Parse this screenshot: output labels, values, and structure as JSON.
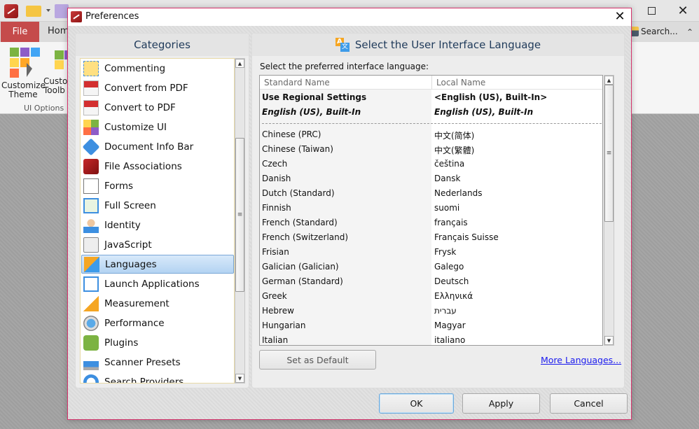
{
  "app": {
    "ribbon_tabs": {
      "file": "File",
      "home": "Hom"
    },
    "ribbon_search": "Search...",
    "ribbon_buttons": [
      {
        "label_line1": "Customize",
        "label_line2": "Theme"
      },
      {
        "label_line1": "Custo",
        "label_line2": "Toolb"
      }
    ],
    "ribbon_group_label": "UI Options",
    "window_controls": {
      "maximize": "□",
      "close": "✕"
    }
  },
  "dialog": {
    "title": "Preferences",
    "close_glyph": "✕",
    "categories": {
      "heading": "Categories",
      "selected": "Languages",
      "items": [
        {
          "label": "Commenting",
          "icon": "commenting-icon"
        },
        {
          "label": "Convert from PDF",
          "icon": "convert-from-pdf-icon"
        },
        {
          "label": "Convert to PDF",
          "icon": "convert-to-pdf-icon"
        },
        {
          "label": "Customize UI",
          "icon": "customize-ui-icon"
        },
        {
          "label": "Document Info Bar",
          "icon": "info-icon"
        },
        {
          "label": "File Associations",
          "icon": "pdf-file-icon"
        },
        {
          "label": "Forms",
          "icon": "forms-icon"
        },
        {
          "label": "Full Screen",
          "icon": "full-screen-icon"
        },
        {
          "label": "Identity",
          "icon": "user-icon"
        },
        {
          "label": "JavaScript",
          "icon": "script-gear-icon"
        },
        {
          "label": "Languages",
          "icon": "language-icon"
        },
        {
          "label": "Launch Applications",
          "icon": "launch-app-icon"
        },
        {
          "label": "Measurement",
          "icon": "ruler-triangle-icon"
        },
        {
          "label": "Performance",
          "icon": "gauge-icon"
        },
        {
          "label": "Plugins",
          "icon": "puzzle-icon"
        },
        {
          "label": "Scanner Presets",
          "icon": "scanner-icon"
        },
        {
          "label": "Search Providers",
          "icon": "globe-icon"
        }
      ]
    },
    "languages": {
      "heading": "Select the User Interface Language",
      "prompt": "Select the preferred interface language:",
      "columns": [
        "Standard Name",
        "Local Name"
      ],
      "pinned_rows": [
        {
          "standard": "Use Regional Settings",
          "local": "<English (US), Built-In>",
          "style": "bold"
        },
        {
          "standard": "English (US), Built-In",
          "local": "English (US), Built-In",
          "style": "bolditalic"
        }
      ],
      "rows": [
        {
          "standard": "Chinese (PRC)",
          "local": "中文(简体)"
        },
        {
          "standard": "Chinese (Taiwan)",
          "local": "中文(繁體)"
        },
        {
          "standard": "Czech",
          "local": "čeština"
        },
        {
          "standard": "Danish",
          "local": "Dansk"
        },
        {
          "standard": "Dutch (Standard)",
          "local": "Nederlands"
        },
        {
          "standard": "Finnish",
          "local": "suomi"
        },
        {
          "standard": "French (Standard)",
          "local": "français"
        },
        {
          "standard": "French (Switzerland)",
          "local": "Français Suisse"
        },
        {
          "standard": "Frisian",
          "local": "Frysk"
        },
        {
          "standard": "Galician (Galician)",
          "local": "Galego"
        },
        {
          "standard": "German (Standard)",
          "local": "Deutsch"
        },
        {
          "standard": "Greek",
          "local": "Ελληνικά"
        },
        {
          "standard": "Hebrew",
          "local": "עברית"
        },
        {
          "standard": "Hungarian",
          "local": "Magyar"
        },
        {
          "standard": "Italian",
          "local": "italiano"
        }
      ],
      "set_default_label": "Set as Default",
      "more_languages_label": "More Languages..."
    },
    "footer": {
      "ok": "OK",
      "apply": "Apply",
      "cancel": "Cancel"
    },
    "scroll_glyphs": {
      "up": "▲",
      "down": "▼",
      "grip": "≡"
    }
  }
}
